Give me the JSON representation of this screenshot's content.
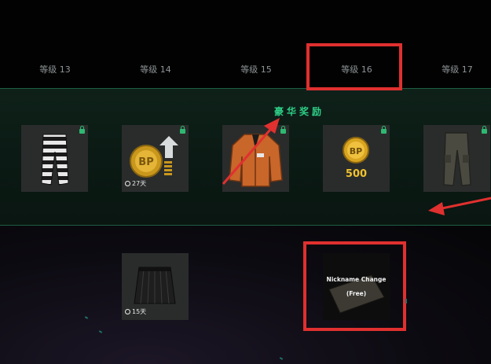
{
  "levels": [
    {
      "label": "等级 13"
    },
    {
      "label": "等级 14"
    },
    {
      "label": "等级 15"
    },
    {
      "label": "等级 16"
    },
    {
      "label": "等级 17"
    }
  ],
  "premium": {
    "title": "豪华奖励",
    "rewards": [
      {
        "icon": "striped-pants-icon",
        "locked": true
      },
      {
        "icon": "bp-coin-stack-icon",
        "locked": true,
        "duration": "27天"
      },
      {
        "icon": "orange-jacket-icon",
        "locked": true
      },
      {
        "icon": "bp-coin-icon",
        "locked": true,
        "amount": "500"
      },
      {
        "icon": "cargo-pants-icon",
        "locked": true
      }
    ]
  },
  "free": {
    "rewards": [
      {
        "icon": "black-skirt-icon",
        "duration": "15天"
      },
      {
        "icon": "nickname-card-icon",
        "line1": "Nickname Change",
        "line2": "(Free)"
      }
    ]
  },
  "colors": {
    "accent_green": "#2ecf87",
    "highlight_red": "#e0302f",
    "coin_gold": "#f0c22c"
  }
}
